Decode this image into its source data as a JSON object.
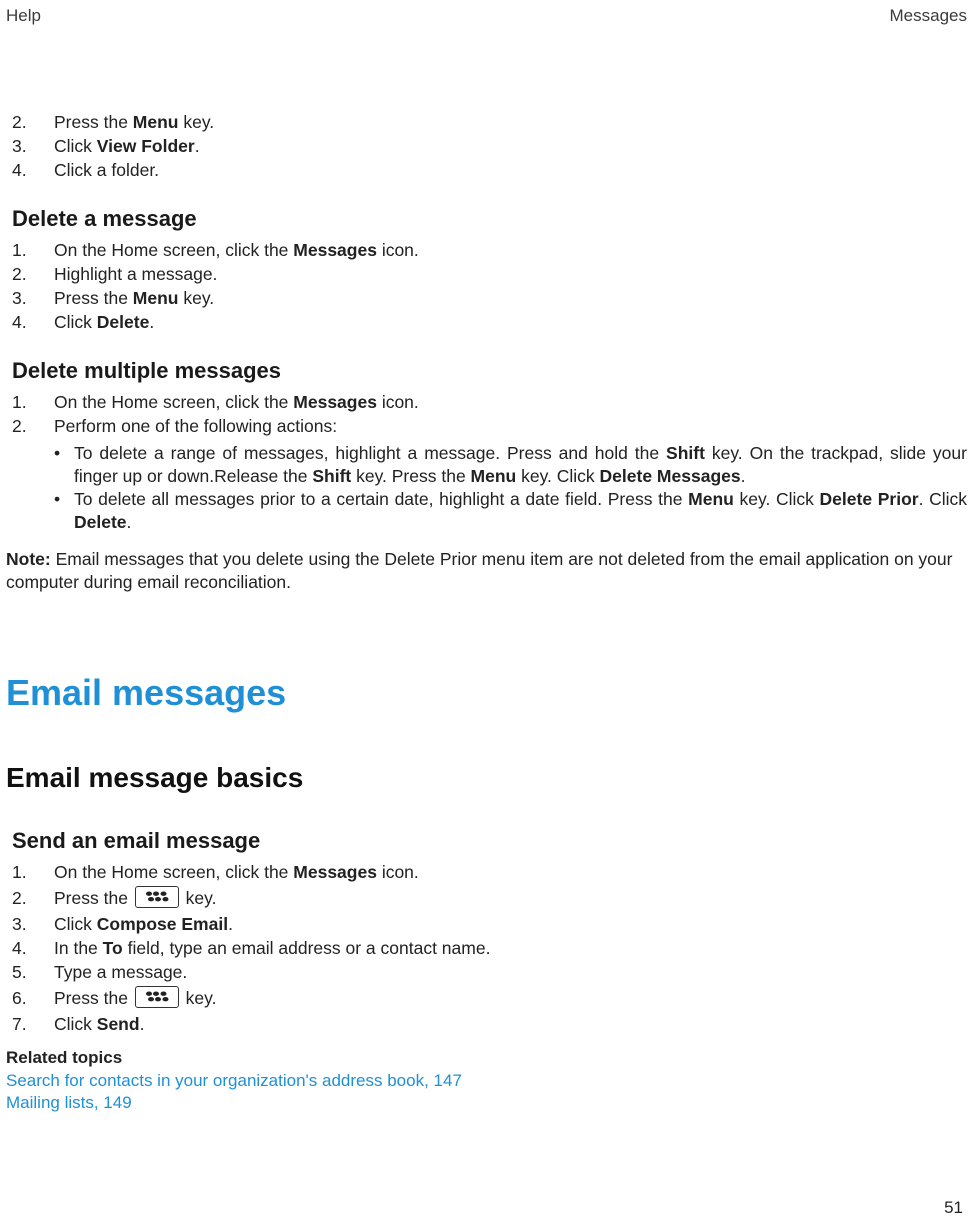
{
  "header": {
    "left": "Help",
    "right": "Messages"
  },
  "partA": {
    "steps": [
      {
        "n": "2.",
        "pre": "Press the ",
        "bold": "Menu",
        "post": " key."
      },
      {
        "n": "3.",
        "pre": "Click ",
        "bold": "View Folder",
        "post": "."
      },
      {
        "n": "4.",
        "pre": "Click a folder.",
        "bold": "",
        "post": ""
      }
    ]
  },
  "secDeleteMsg": {
    "title": "Delete a message",
    "steps": [
      {
        "pre": "On the Home screen, click the ",
        "bold": "Messages",
        "post": " icon."
      },
      {
        "pre": "Highlight a message.",
        "bold": "",
        "post": ""
      },
      {
        "pre": "Press the ",
        "bold": "Menu",
        "post": " key."
      },
      {
        "pre": "Click ",
        "bold": "Delete",
        "post": "."
      }
    ]
  },
  "secDeleteMulti": {
    "title": "Delete multiple messages",
    "steps": [
      {
        "pre": "On the Home screen, click the ",
        "bold": "Messages",
        "post": " icon."
      },
      {
        "pre": "Perform one of the following actions:",
        "bold": "",
        "post": ""
      }
    ],
    "bullets": {
      "b1": {
        "p0": "To delete a range of messages, highlight a message. Press and hold the ",
        "b0": "Shift",
        "p1": " key. On the trackpad, slide your finger up or down.Release the ",
        "b1": "Shift",
        "p2": " key. Press the ",
        "b2": "Menu",
        "p3": " key. Click ",
        "b3": "Delete Messages",
        "p4": "."
      },
      "b2": {
        "p0": "To delete all messages prior to a certain date, highlight a date field. Press the ",
        "b0": "Menu",
        "p1": " key. Click ",
        "b1": "Delete Prior",
        "p2": ". Click ",
        "b2": "Delete",
        "p3": "."
      }
    },
    "noteLabel": "Note:",
    "noteBody": "  Email messages that you delete using the Delete Prior menu item are not deleted from the email application on your computer during email reconciliation."
  },
  "h1": "Email messages",
  "h2": "Email message basics",
  "secSend": {
    "title": "Send an email message",
    "steps": {
      "s1": {
        "pre": "On the Home screen, click the ",
        "bold": "Messages",
        "post": " icon."
      },
      "s2": {
        "pre": "Press the ",
        "post": " key."
      },
      "s3": {
        "pre": "Click ",
        "bold": "Compose Email",
        "post": "."
      },
      "s4": {
        "pre": "In the ",
        "bold": "To",
        "post": " field, type an email address or a contact name."
      },
      "s5": {
        "pre": "Type a message."
      },
      "s6": {
        "pre": "Press the ",
        "post": " key."
      },
      "s7": {
        "pre": "Click ",
        "bold": "Send",
        "post": "."
      }
    }
  },
  "related": {
    "heading": "Related topics",
    "links": [
      "Search for contacts in your organization's address book, 147",
      "Mailing lists, 149"
    ]
  },
  "pageNumber": "51"
}
